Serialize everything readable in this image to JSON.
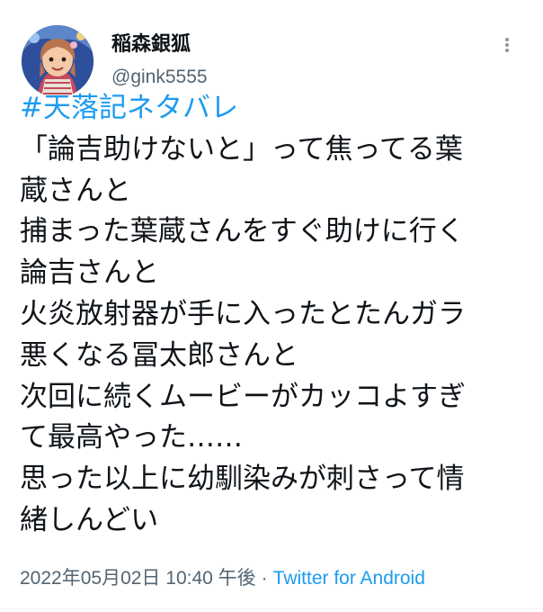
{
  "author": {
    "display_name": "稲森銀狐",
    "handle": "@gink5555"
  },
  "tweet": {
    "hashtag": "#天落記ネタバレ",
    "lines": [
      "「論吉助けないと」って焦ってる葉",
      "蔵さんと",
      "捕まった葉蔵さんをすぐ助けに行く",
      "論吉さんと",
      "火炎放射器が手に入ったとたんガラ",
      "悪くなる冨太郎さんと",
      "次回に続くムービーがカッコよすぎ",
      "て最高やった……",
      "思った以上に幼馴染みが刺さって情",
      "緒しんどい"
    ]
  },
  "meta": {
    "timestamp": "2022年05月02日 10:40 午後",
    "separator": "·",
    "source": "Twitter for Android"
  },
  "icons": {
    "more": "more-dots-icon"
  },
  "colors": {
    "link": "#1d9bf0",
    "secondary_text": "#536471",
    "primary_text": "#0f1419"
  }
}
